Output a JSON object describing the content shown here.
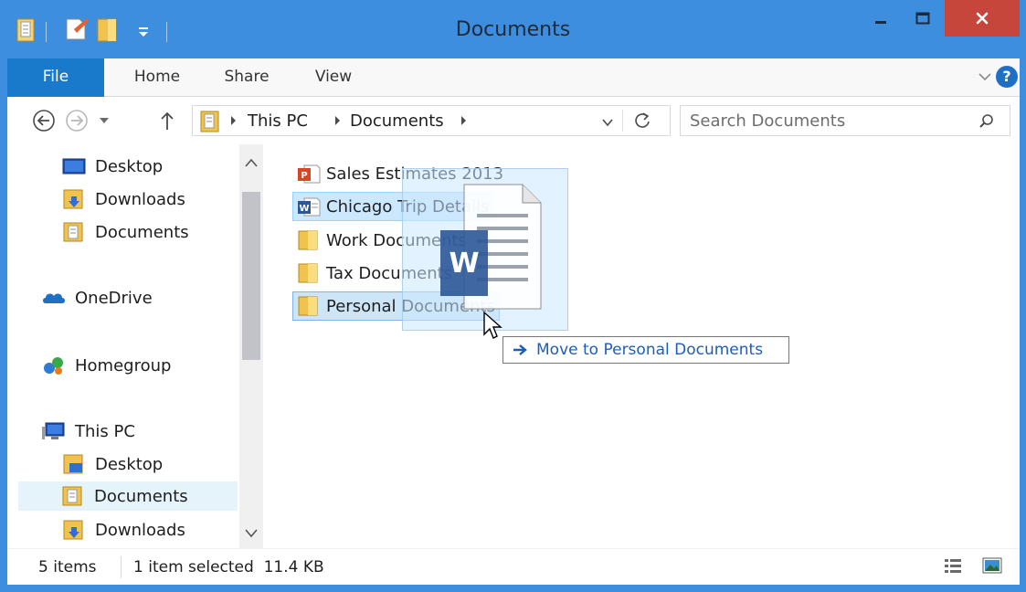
{
  "window": {
    "title": "Documents"
  },
  "ribbon": {
    "tabs": [
      {
        "label": "File"
      },
      {
        "label": "Home"
      },
      {
        "label": "Share"
      },
      {
        "label": "View"
      }
    ],
    "help_label": "?"
  },
  "address": {
    "breadcrumbs": [
      "This PC",
      "Documents"
    ],
    "search_placeholder": "Search Documents"
  },
  "nav": {
    "items": [
      {
        "label": "Desktop",
        "icon": "desktop-icon"
      },
      {
        "label": "Downloads",
        "icon": "downloads-folder-icon"
      },
      {
        "label": "Documents",
        "icon": "documents-folder-icon"
      },
      {
        "label": "OneDrive",
        "icon": "onedrive-icon"
      },
      {
        "label": "Homegroup",
        "icon": "homegroup-icon"
      },
      {
        "label": "This PC",
        "icon": "computer-icon"
      },
      {
        "label": "Desktop",
        "icon": "desktop-folder-icon"
      },
      {
        "label": "Documents",
        "icon": "documents-folder-icon",
        "selected": true
      },
      {
        "label": "Downloads",
        "icon": "downloads-folder-icon"
      }
    ]
  },
  "files": [
    {
      "name": "Sales Estimates 2013",
      "icon": "powerpoint-file-icon"
    },
    {
      "name": "Chicago Trip Details",
      "icon": "word-file-icon",
      "selected": true
    },
    {
      "name": "Work Documents",
      "icon": "folder-icon"
    },
    {
      "name": "Tax Documents",
      "icon": "folder-icon"
    },
    {
      "name": "Personal Documents",
      "icon": "folder-icon",
      "drop_target": true
    }
  ],
  "drag": {
    "tooltip": "Move to Personal Documents",
    "badge_letter": "W"
  },
  "status": {
    "item_count": "5 items",
    "selection": "1 item selected  11.4 KB"
  },
  "colors": {
    "titlebar": "#3e8ee0",
    "file_tab": "#1979ca",
    "close_button": "#c7463b",
    "selection": "#cce8ff",
    "word_blue": "#2b5797",
    "folder_yellow": "#f0c34e"
  }
}
